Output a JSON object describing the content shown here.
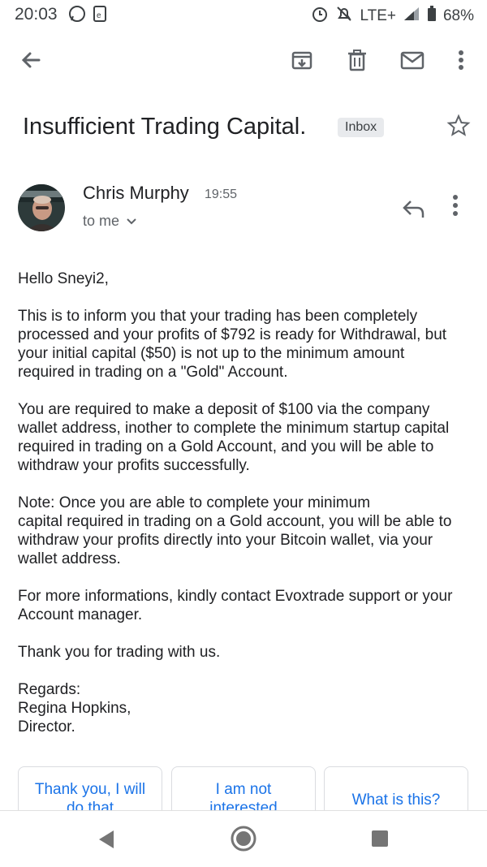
{
  "status_bar": {
    "time": "20:03",
    "network": "LTE+",
    "battery": "68%"
  },
  "toolbar": {
    "back_icon": "arrow-left-icon",
    "archive_icon": "archive-icon",
    "delete_icon": "trash-icon",
    "mark_unread_icon": "mail-icon",
    "more_icon": "more-vert-icon"
  },
  "email": {
    "subject": "Insufficient Trading Capital.",
    "label": "Inbox",
    "sender": "Chris Murphy",
    "time": "19:55",
    "recipient": "to me",
    "body": {
      "p1": "Hello Sneyi2,",
      "p2": "This is to inform you that your trading has been completely\nprocessed and your profits of $792 is ready for Withdrawal, but\nyour initial capital ($50) is not up to the minimum amount\nrequired in trading on a \"Gold\" Account.",
      "p3": "You are required to make a deposit of $100 via the company\nwallet address, inother to complete the minimum startup capital\nrequired in trading on a Gold Account, and you will be able to\nwithdraw your profits successfully.",
      "p4": "Note: Once you are able to complete your minimum\ncapital required in trading on a Gold account, you will be able to\nwithdraw your profits directly into your Bitcoin wallet, via your\nwallet address.",
      "p5": "For more informations, kindly contact Evoxtrade support or your\nAccount manager.",
      "p6": "Thank you for trading with us.",
      "p7": "Regards:\nRegina Hopkins,\nDirector."
    }
  },
  "smart_replies": {
    "r1_line1": "Thank you, I will",
    "r1_line2": "do that",
    "r2_line1": "I am not",
    "r2_line2": "interested",
    "r3": "What is this?"
  },
  "colors": {
    "accent": "#1a73e8",
    "text": "#202124",
    "muted": "#5f6368"
  }
}
